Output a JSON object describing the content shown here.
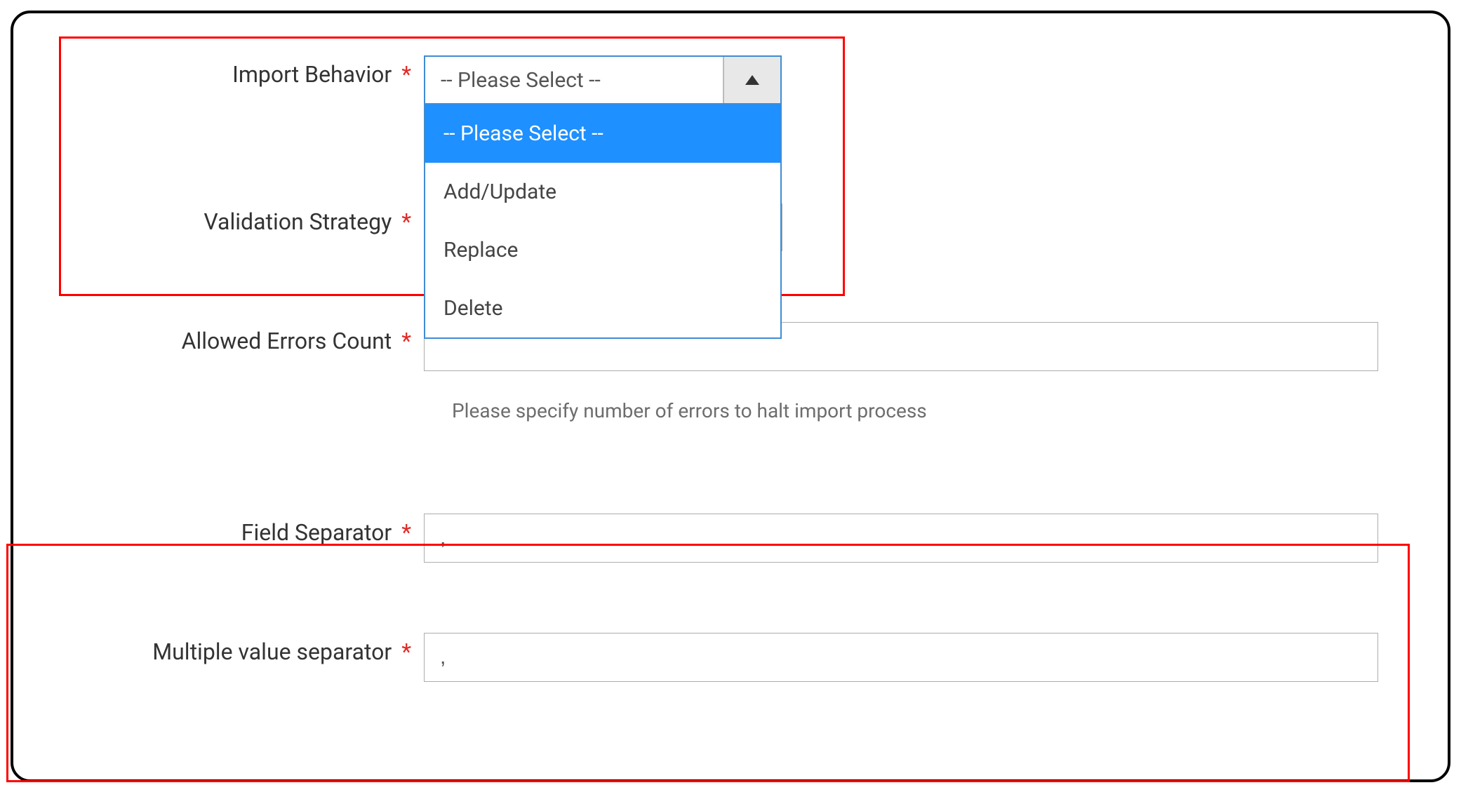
{
  "form": {
    "import_behavior": {
      "label": "Import Behavior",
      "selected": "-- Please Select --",
      "options": [
        "-- Please Select --",
        "Add/Update",
        "Replace",
        "Delete"
      ]
    },
    "validation_strategy": {
      "label": "Validation Strategy"
    },
    "allowed_errors": {
      "label": "Allowed Errors Count",
      "value": "",
      "help": "Please specify number of errors to halt import process"
    },
    "field_separator": {
      "label": "Field Separator",
      "value": ","
    },
    "multiple_value_separator": {
      "label": "Multiple value separator",
      "value": ","
    },
    "required_mark": "*"
  }
}
